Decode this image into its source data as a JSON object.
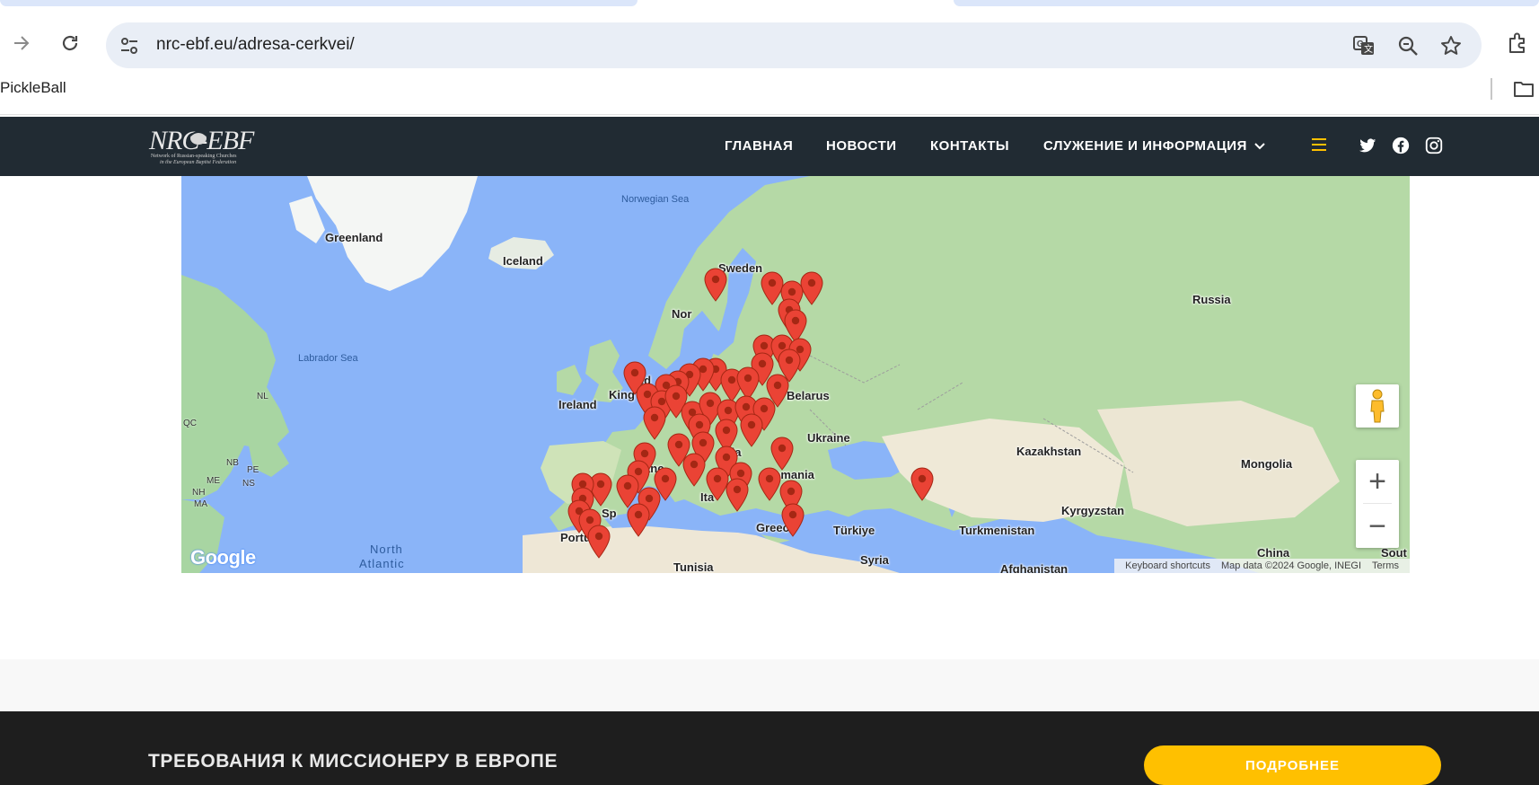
{
  "browser": {
    "url": "nrc-ebf.eu/adresa-cerkvei/",
    "bookmark_label": "PickleBall"
  },
  "site": {
    "logo_text": "NRC-EBF",
    "logo_subtitle_1": "Network of Russian-speaking Churches",
    "logo_subtitle_2": "in the European Baptist Federation",
    "menu": [
      {
        "label": "ГЛАВНАЯ"
      },
      {
        "label": "НОВОСТИ"
      },
      {
        "label": "КОНТАКТЫ"
      },
      {
        "label": "СЛУЖЕНИЕ И ИНФОРМАЦИЯ"
      }
    ],
    "accent_color": "#ffc000",
    "header_color": "#212b33"
  },
  "map": {
    "labels": {
      "norwegian_sea": "Norwegian Sea",
      "greenland": "Greenland",
      "iceland": "Iceland",
      "sweden": "Sweden",
      "russia": "Russia",
      "norway": "Nor",
      "labrador_sea": "Labrador Sea",
      "nl": "NL",
      "qc": "QC",
      "ireland": "Ireland",
      "united_kingdom": "ited",
      "kingdom": "King",
      "belarus": "Belarus",
      "ukraine": "Ukraine",
      "kazakhstan": "Kazakhstan",
      "mongolia": "Mongolia",
      "nb": "NB",
      "pe": "PE",
      "me": "ME",
      "ns": "NS",
      "nh": "NH",
      "ma": "MA",
      "france": "ranc",
      "austria": "stria",
      "romania": "Romania",
      "spain": "Sp",
      "italy": "Ita",
      "kyrgyzstan": "Kyrgyzstan",
      "portugal": "Portugal",
      "greece": "Greec",
      "turkiye": "Türkiye",
      "turkmenistan": "Turkmenistan",
      "china": "China",
      "south": "Sout",
      "north_atlantic_1": "North",
      "north_atlantic_2": "Atlantic",
      "tunisia": "Tunisia",
      "syria": "Syria",
      "afghanistan": "Afghanistan"
    },
    "zoom_in": "+",
    "zoom_out": "−",
    "google_logo": "Google",
    "attribution": {
      "shortcuts": "Keyboard shortcuts",
      "map_data": "Map data ©2024 Google, INEGI",
      "terms": "Terms"
    }
  },
  "cta": {
    "title": "ТРЕБОВАНИЯ К МИССИОНЕРУ В ЕВРОПЕ",
    "button_label": "ПОДРОБНЕЕ"
  }
}
